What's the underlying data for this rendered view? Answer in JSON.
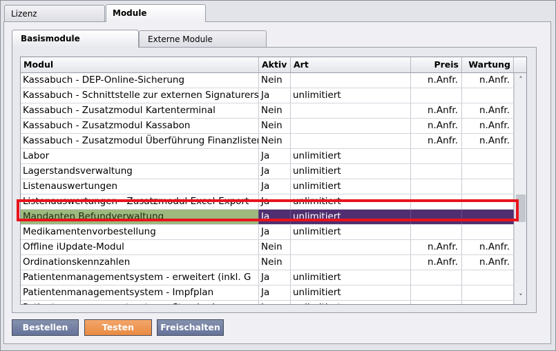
{
  "top_tabs": [
    {
      "label": "Lizenz",
      "active": false
    },
    {
      "label": "Module",
      "active": true
    }
  ],
  "inner_tabs": [
    {
      "label": "Basismodule",
      "active": true
    },
    {
      "label": "Externe Module",
      "active": false
    }
  ],
  "table": {
    "columns": [
      "Modul",
      "Aktiv",
      "Art",
      "Preis",
      "Wartung"
    ],
    "rows": [
      [
        "Kassabuch - DEP-Online-Sicherung",
        "Nein",
        "",
        "n.Anfr.",
        "n.Anfr."
      ],
      [
        "Kassabuch - Schnittstelle zur externen Signaturerstellung",
        "Ja",
        "unlimitiert",
        "",
        ""
      ],
      [
        "Kassabuch - Zusatzmodul Kartenterminal",
        "Nein",
        "",
        "n.Anfr.",
        "n.Anfr."
      ],
      [
        "Kassabuch - Zusatzmodul Kassabon",
        "Nein",
        "",
        "n.Anfr.",
        "n.Anfr."
      ],
      [
        "Kassabuch - Zusatzmodul Überführung Finanzlisten",
        "Nein",
        "",
        "n.Anfr.",
        "n.Anfr."
      ],
      [
        "Labor",
        "Ja",
        "unlimitiert",
        "",
        ""
      ],
      [
        "Lagerstandsverwaltung",
        "Ja",
        "unlimitiert",
        "",
        ""
      ],
      [
        "Listenauswertungen",
        "Ja",
        "unlimitiert",
        "",
        ""
      ],
      [
        "Listenauswertungen - Zusatzmodul Excel-Export",
        "Ja",
        "unlimitiert",
        "",
        ""
      ],
      [
        "Mandanten Befundverwaltung",
        "Ja",
        "unlimitiert",
        "",
        ""
      ],
      [
        "Medikamentenvorbestellung",
        "Ja",
        "unlimitiert",
        "",
        ""
      ],
      [
        "Offline iUpdate-Modul",
        "Nein",
        "",
        "n.Anfr.",
        "n.Anfr."
      ],
      [
        "Ordinationskennzahlen",
        "Nein",
        "",
        "n.Anfr.",
        "n.Anfr."
      ],
      [
        "Patientenmanagementsystem - erweitert (inkl. G",
        "Ja",
        "unlimitiert",
        "",
        ""
      ],
      [
        "Patientenmanagementsystem - Impfplan",
        "Ja",
        "unlimitiert",
        "",
        ""
      ],
      [
        "Patientenmanagementsystem - Standard",
        "Ja",
        "unlimitiert",
        "",
        ""
      ]
    ],
    "selected_row": 9
  },
  "buttons": {
    "bestellen": "Bestellen",
    "testen": "Testen",
    "freischalten": "Freischalten"
  },
  "icons": {
    "scroll_up": "chevron-up-icon",
    "scroll_down": "chevron-down-icon"
  },
  "colors": {
    "selected_row": "#4f2f6f",
    "selected_first_cell": "#9db97e",
    "highlight_border": "#e8141c",
    "button_blue": "#6f7ca0",
    "button_orange": "#ee9450"
  }
}
